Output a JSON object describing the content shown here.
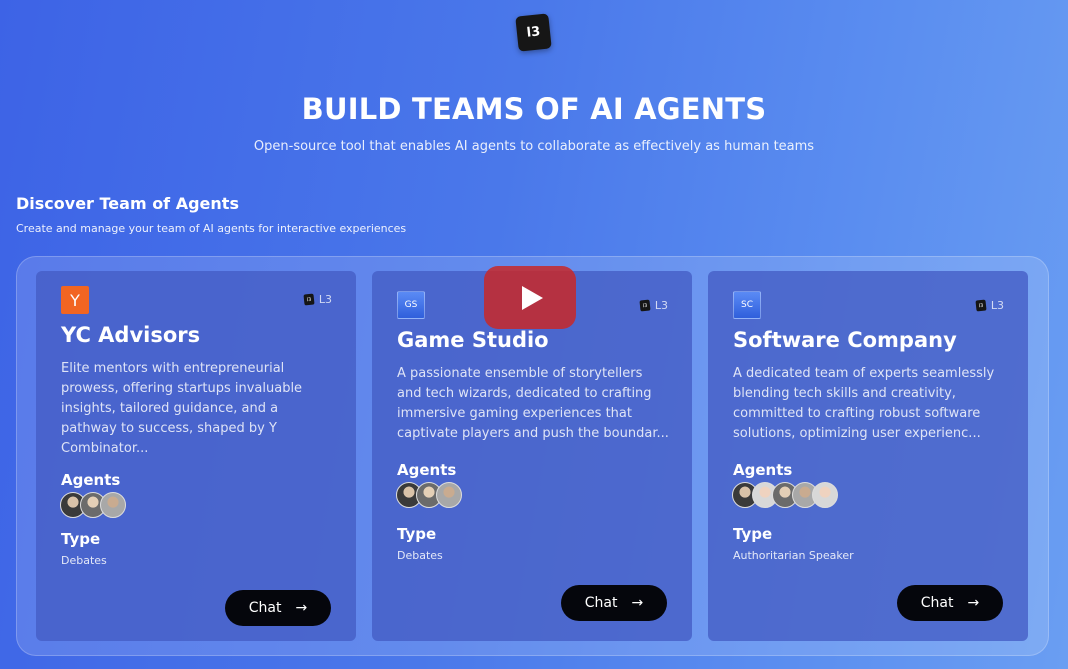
{
  "logo": {
    "text": "l3"
  },
  "hero": {
    "title": "BUILD TEAMS OF AI AGENTS",
    "subtitle": "Open-source tool that enables AI agents to collaborate as effectively as human teams"
  },
  "section": {
    "title": "Discover Team of Agents",
    "subtitle": "Create and manage your team of AI agents for interactive experiences"
  },
  "cards": [
    {
      "badge": "Y",
      "brand": "L3",
      "name": "YC Advisors",
      "description": "Elite mentors with entrepreneurial prowess, offering startups invaluable insights, tailored guidance, and a pathway to success, shaped by Y Combinator...",
      "agents_label": "Agents",
      "type_label": "Type",
      "type_value": "Debates",
      "chat_label": "Chat"
    },
    {
      "badge": "GS",
      "brand": "L3",
      "name": "Game Studio",
      "description": "A passionate ensemble of storytellers and tech wizards, dedicated to crafting immersive gaming experiences that captivate players and push the boundar...",
      "agents_label": "Agents",
      "type_label": "Type",
      "type_value": "Debates",
      "chat_label": "Chat"
    },
    {
      "badge": "SC",
      "brand": "L3",
      "name": "Software Company",
      "description": "A dedicated team of experts seamlessly blending tech skills and creativity, committed to crafting robust software solutions, optimizing user experienc...",
      "agents_label": "Agents",
      "type_label": "Type",
      "type_value": "Authoritarian Speaker",
      "chat_label": "Chat"
    }
  ],
  "icons": {
    "arrow": "→",
    "brand_mini": "l3"
  }
}
